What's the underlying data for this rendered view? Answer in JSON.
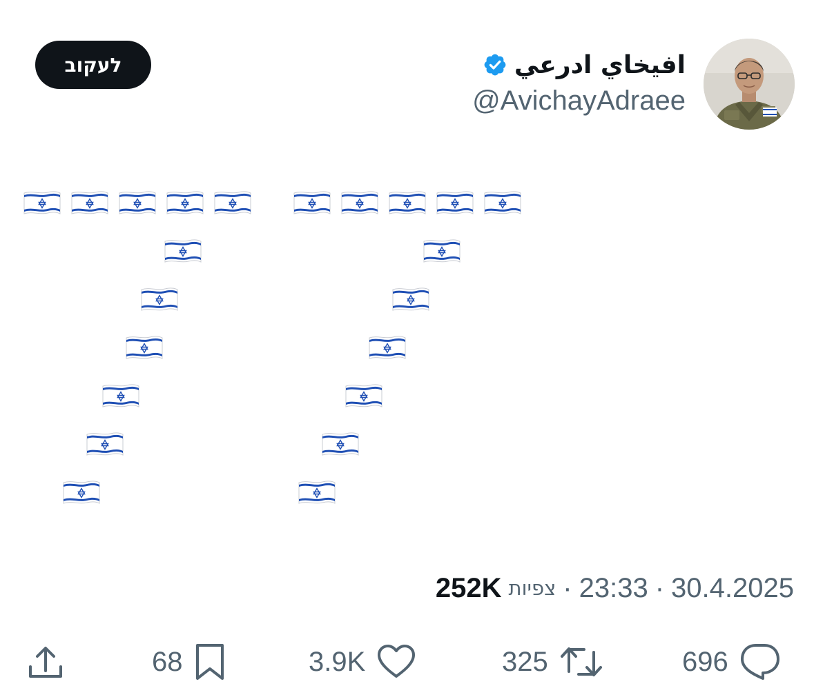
{
  "header": {
    "follow_label": "לעקוב",
    "display_name": "افيخاي ادرعي",
    "handle": "@AvichayAdraee"
  },
  "icons": {
    "verified": "verified-badge-icon",
    "avatar": "profile-photo",
    "flag": "israel-flag-emoji"
  },
  "colors": {
    "text_primary": "#0f1419",
    "text_secondary": "#536471",
    "verified_blue": "#1d9bf0",
    "flag_blue": "#1f4fb4",
    "button_bg": "#0f1419"
  },
  "post": {
    "flag_emoji": "🇮🇱",
    "flag_count": 22
  },
  "meta": {
    "date": "30.4.2025",
    "separator": "·",
    "time": "23:33",
    "views_label": "צפיות",
    "views_count": "252K"
  },
  "actions": {
    "replies": "696",
    "reposts": "325",
    "likes": "3.9K",
    "bookmarks": "68"
  }
}
